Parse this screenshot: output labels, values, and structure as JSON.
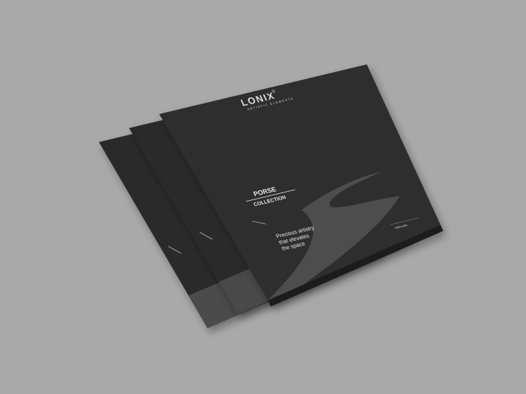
{
  "brochure": {
    "brand": "LONIX",
    "brand_mark": "®",
    "brand_tagline": "ARTISTIC ELEMENTS",
    "collection_name": "PORSE",
    "collection_label": "COLLECTION",
    "slogan_line_1": "Precious artistry",
    "slogan_line_2": "that elevates",
    "slogan_line_3": "the space",
    "back_cover_website": "lonix.com",
    "colors": {
      "background": "#a9a9a9",
      "cover": "#2b2b2b",
      "swoosh": "#4a4a4a",
      "text": "#e6e6e6"
    }
  }
}
